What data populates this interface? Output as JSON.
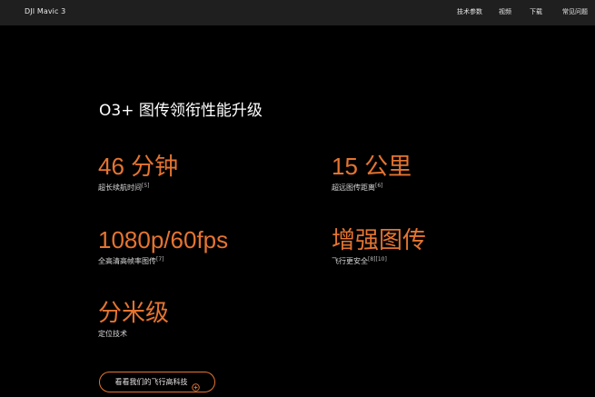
{
  "navbar": {
    "title": "DJI Mavic 3",
    "links": [
      "技术参数",
      "视频",
      "下载",
      "常见问题"
    ]
  },
  "section": {
    "title": "O3+ 图传领衔性能升级"
  },
  "stats": [
    {
      "value": "46 分钟",
      "label": "超长续航时间",
      "note": "[5]"
    },
    {
      "value": "15 公里",
      "label": "超远图传距离",
      "note": "[6]"
    },
    {
      "value": "1080p/60fps",
      "label": "全高清高帧率图传",
      "note": "[7]"
    },
    {
      "value": "增强图传",
      "label": "飞行更安全",
      "note": "[8][10]"
    },
    {
      "value": "分米级",
      "label": "定位技术",
      "note": ""
    }
  ],
  "cta": {
    "label": "看看我们的飞行高科技",
    "icon": "plus-circle-icon"
  },
  "colors": {
    "accent": "#e57430",
    "navbar_bg": "#1f1f1f",
    "page_bg": "#000000"
  }
}
